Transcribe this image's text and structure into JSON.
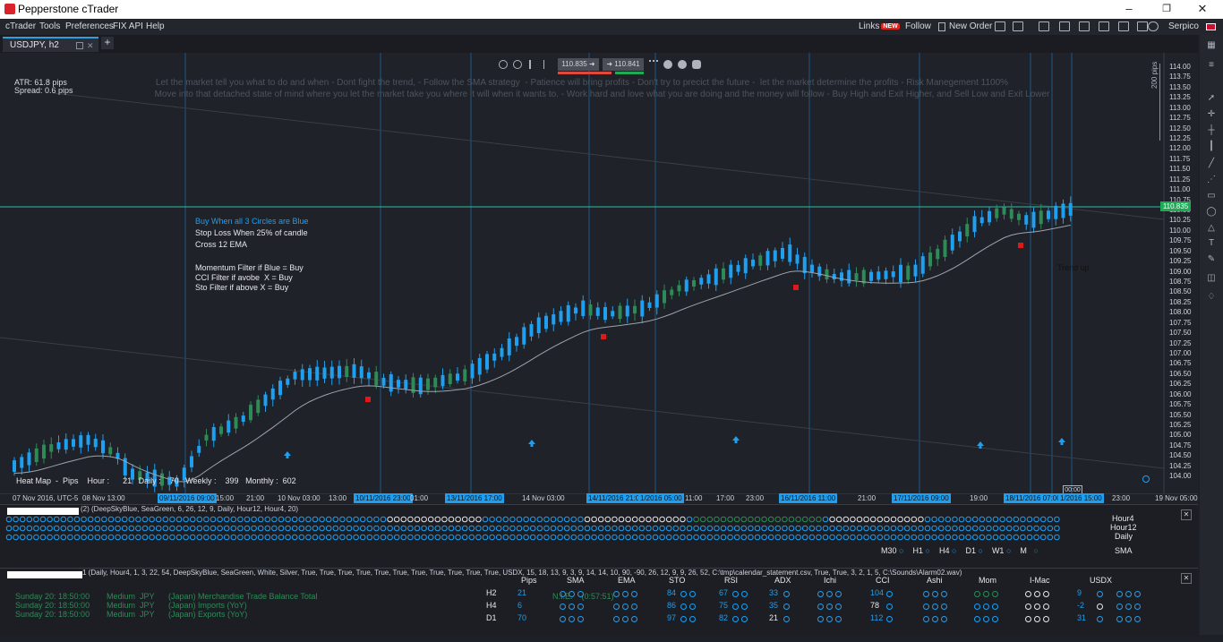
{
  "window": {
    "title": "Pepperstone cTrader",
    "min": "–",
    "max": "❐",
    "close": "✕"
  },
  "menu": {
    "items": [
      "cTrader",
      "Tools",
      "Preferences",
      "FIX API",
      "Help"
    ],
    "right": {
      "links": "Links",
      "new_badge": "NEW",
      "follow": "Follow",
      "new_order": "New Order",
      "user": "Serpico"
    }
  },
  "tab": {
    "label": "USDJPY, h2",
    "add": "+"
  },
  "chart": {
    "info": {
      "atr": "ATR: 61.8 pips",
      "spread": "Spread: 0.6 pips"
    },
    "quote": {
      "bid": "110.835",
      "ask": "110.841"
    },
    "banner1": "Let the market tell you what to do and when - Dont fight the trend, - Follow the SMA strategy  - Patience will bring profits - Don't try to precict the future -  let the market determine the profits - Risk Manegement 1100%",
    "banner2": "Move into that detached state of mind where you let the market take you where it will when it wants to. - Work hard and love what you are doing and the money will follow - Buy High and Exit Higher, and Sell Low and Exit Lower",
    "notes": {
      "buy": "Buy When all 3 Circles are Blue",
      "stop": "Stop Loss When 25% of candle",
      "cross": "Cross 12 EMA",
      "mom": "Momentum Filter if Blue = Buy",
      "cci": "CCI Filter if avobe  X = Buy",
      "sto": "Sto Filter if above X = Buy"
    },
    "trend_label": "Trend up",
    "pips_scale": "200 pips",
    "price_tag": "110.835",
    "heatmap": {
      "label": "Heat Map  -  Pips    Hour :",
      "hour": "21",
      "daily_label": "Daily :",
      "daily": "70",
      "weekly_label": "Weekly :",
      "weekly": "399",
      "monthly_label": "Monthly :",
      "monthly": "602"
    },
    "y_ticks": [
      "114.00",
      "113.75",
      "113.50",
      "113.25",
      "113.00",
      "112.75",
      "112.50",
      "112.25",
      "112.00",
      "111.75",
      "111.50",
      "111.25",
      "111.00",
      "110.75",
      "110.50",
      "110.25",
      "110.00",
      "109.75",
      "109.50",
      "109.25",
      "109.00",
      "108.75",
      "108.50",
      "108.25",
      "108.00",
      "107.75",
      "107.50",
      "107.25",
      "107.00",
      "106.75",
      "106.50",
      "106.25",
      "106.00",
      "105.75",
      "105.50",
      "105.25",
      "105.00",
      "104.75",
      "104.50",
      "104.25",
      "104.00"
    ],
    "x_ticks": [
      {
        "t": "07 Nov 2016, UTC-5",
        "hl": false
      },
      {
        "t": "08 Nov 13:00",
        "hl": false
      },
      {
        "t": "09/11/2016 09:00",
        "hl": true
      },
      {
        "t": "15:00",
        "hl": false
      },
      {
        "t": "21:00",
        "hl": false
      },
      {
        "t": "10 Nov 03:00",
        "hl": false
      },
      {
        "t": "13:00",
        "hl": false
      },
      {
        "t": "10/11/2016 23:00",
        "hl": true
      },
      {
        "t": "01:00",
        "hl": false
      },
      {
        "t": "13/11/2016 17:00",
        "hl": true
      },
      {
        "t": "14 Nov 03:00",
        "hl": false
      },
      {
        "t": "14/11/2016 21:00",
        "hl": true
      },
      {
        "t": "1/2016 05:00",
        "hl": true
      },
      {
        "t": "11:00",
        "hl": false
      },
      {
        "t": "17:00",
        "hl": false
      },
      {
        "t": "23:00",
        "hl": false
      },
      {
        "t": "16/11/2016 11:00",
        "hl": true
      },
      {
        "t": "21:00",
        "hl": false
      },
      {
        "t": "17/11/2016 09:00",
        "hl": true
      },
      {
        "t": "19:00",
        "hl": false
      },
      {
        "t": "18/11/2016 07:00",
        "hl": true
      },
      {
        "t": "1/2016 15:00",
        "hl": true
      },
      {
        "t": "23:00",
        "hl": false
      },
      {
        "t": "19 Nov 05:00",
        "hl": false
      }
    ],
    "time_box": "00:00"
  },
  "panel1": {
    "params": "(2) (DeepSkyBlue, SeaGreen, 6, 26, 12, 9, Daily, Hour12, Hour4, 20)",
    "tf": [
      "Hour4",
      "Hour12",
      "Daily"
    ],
    "sma_row": [
      "M30",
      "H1",
      "H4",
      "D1",
      "W1",
      "M"
    ],
    "sma_label": "SMA"
  },
  "panel2": {
    "params": "1 (Daily, Hour4, 1, 3, 22, 54, DeepSkyBlue, SeaGreen, White, Silver, True, True, True, True, True, True, True, True, True, True, True, USDX, 15, 18, 13, 9, 3, 9, 14, 14, 10, 90, -90, 26, 12, 9, 9, 26, 52, C:\\tmp\\calendar_statement.csv, True, True, 3, 2, 1, 5, C:\\Sounds\\Alarm02.wav)",
    "events": [
      {
        "time": "Sunday 20: 18:50:00",
        "impact": "Medium  JPY",
        "desc": "(Japan) Merchandise Trade Balance Total"
      },
      {
        "time": "Sunday 20: 18:50:00",
        "impact": "Medium  JPY",
        "desc": "(Japan) Imports (YoY)"
      },
      {
        "time": "Sunday 20: 18:50:00",
        "impact": "Medium  JPY",
        "desc": "(Japan) Exports (YoY)"
      }
    ],
    "nie": "N.I.E.    (0:57:51)",
    "headers": [
      "Pips",
      "SMA",
      "EMA",
      "STO",
      "RSI",
      "ADX",
      "Ichi",
      "CCI",
      "Ashi",
      "Mom",
      "I-Mac",
      "USDX"
    ],
    "rows": [
      {
        "tf": "H2",
        "pips": "21",
        "sto": "84",
        "rsi": "67",
        "adx": "33",
        "cci": "104",
        "usdx": "9"
      },
      {
        "tf": "H4",
        "pips": "6",
        "sto": "86",
        "rsi": "75",
        "adx": "35",
        "cci": "78",
        "usdx": "-2"
      },
      {
        "tf": "D1",
        "pips": "70",
        "sto": "97",
        "rsi": "82",
        "adx": "21",
        "cci": "112",
        "usdx": "31"
      }
    ]
  },
  "colors": {
    "bull": "#1e9ff0",
    "bear": "#2e8b57",
    "price_line": "#2bc0a7",
    "grid_blue": "#1d5a86",
    "bg": "#1f2229"
  }
}
